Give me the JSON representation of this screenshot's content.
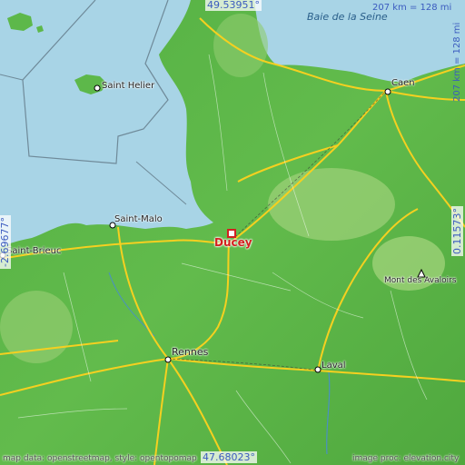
{
  "map": {
    "colors": {
      "sea": "#a8d4e6",
      "land": "#5db84a",
      "highland": "#9fd27a",
      "roads": "#f5d020",
      "water_label": "#2a5f8a",
      "marker": "#d32020"
    },
    "place_name": "Ducey",
    "coords": {
      "top": "49.53951°",
      "bottom": "47.68023°",
      "left": "-2.69677°",
      "right": "0.11573°"
    },
    "scale": {
      "top": "207 km = 128 mi",
      "right": "207 km = 128 mi"
    },
    "sea_label": "Baie de la Seine",
    "cities": [
      {
        "name": "Caen"
      },
      {
        "name": "Saint Helier"
      },
      {
        "name": "Saint-Malo"
      },
      {
        "name": "Saint-Brieuc"
      },
      {
        "name": "Rennes"
      },
      {
        "name": "Laval"
      },
      {
        "name": "Mont des Avaloirs"
      }
    ],
    "attribution": {
      "left": "map data: openstreetmap, style: opentopomap",
      "right": "image proc: elevation.city"
    }
  }
}
